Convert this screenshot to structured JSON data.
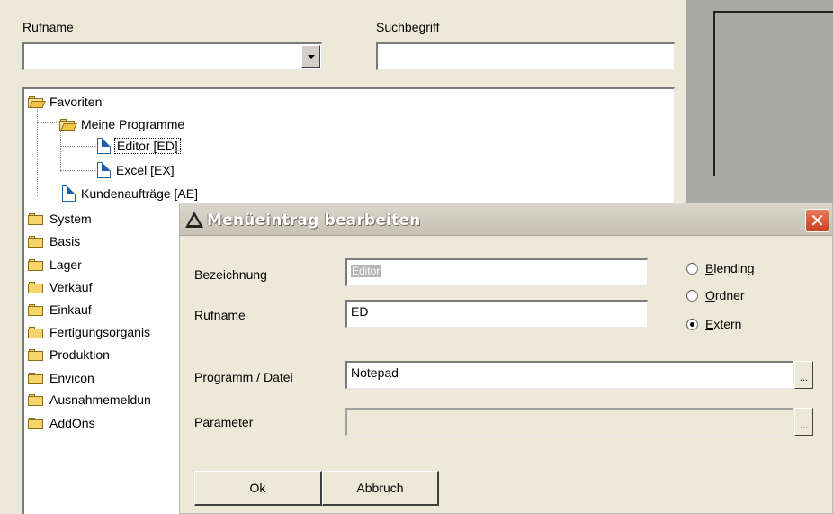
{
  "filter": {
    "rufname_label": "Rufname",
    "rufname_value": "",
    "suchbegriff_label": "Suchbegriff",
    "suchbegriff_value": ""
  },
  "tree": {
    "favoriten": "Favoriten",
    "meine_programme": "Meine Programme",
    "editor": "Editor  [ED]",
    "excel": "Excel  [EX]",
    "kundenauftraege": "Kundenaufträge  [AE]",
    "folders": [
      "System",
      "Basis",
      "Lager",
      "Verkauf",
      "Einkauf",
      "Fertigungsorganis",
      "Produktion",
      "Envicon",
      "Ausnahmemeldun",
      "AddOns"
    ]
  },
  "dialog": {
    "title": "Menüeintrag bearbeiten",
    "bezeichnung_label": "Bezeichnung",
    "bezeichnung_value": "Editor",
    "rufname_label": "Rufname",
    "rufname_value": "ED",
    "programm_label": "Programm / Datei",
    "programm_value": "Notepad",
    "parameter_label": "Parameter",
    "parameter_value": "",
    "ellipsis": "...",
    "radio": {
      "blending_first": "B",
      "blending_rest": "lending",
      "ordner_first": "O",
      "ordner_rest": "rdner",
      "extern_first": "E",
      "extern_rest": "xtern",
      "selected": "Extern"
    },
    "ok_label": "Ok",
    "cancel_label": "Abbruch",
    "close_glyph": "✕"
  }
}
